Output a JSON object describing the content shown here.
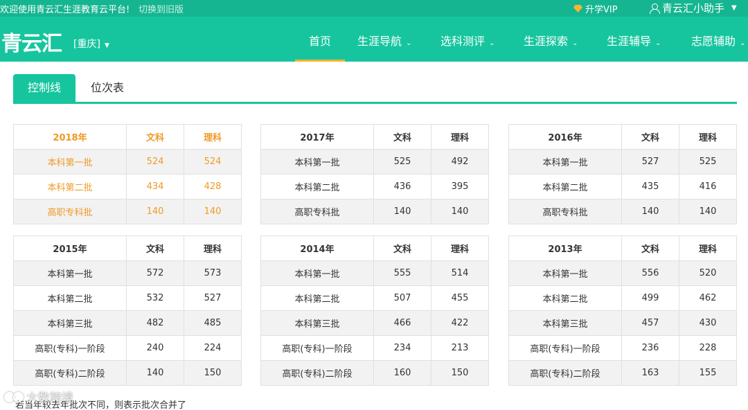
{
  "topbar": {
    "welcome": "欢迎使用青云汇生涯教育云平台!",
    "switch_link": "切换到旧版",
    "vip": "升学VIP",
    "helper": "青云汇小助手"
  },
  "nav": {
    "logo": "青云汇",
    "city": "[重庆]",
    "items": [
      {
        "label": "首页"
      },
      {
        "label": "生涯导航"
      },
      {
        "label": "选科测评"
      },
      {
        "label": "生涯探索"
      },
      {
        "label": "生涯辅导"
      },
      {
        "label": "志愿辅助"
      }
    ]
  },
  "tabs": [
    {
      "label": "控制线"
    },
    {
      "label": "位次表"
    }
  ],
  "colors": {
    "brand": "#16c59e",
    "accent": "#f09a26",
    "vip": "#f7b52d"
  },
  "tables": [
    {
      "year": "2018年",
      "col1": "文科",
      "col2": "理科",
      "rows": [
        {
          "batch": "本科第一批",
          "wen": "524",
          "li": "524"
        },
        {
          "batch": "本科第二批",
          "wen": "434",
          "li": "428"
        },
        {
          "batch": "高职专科批",
          "wen": "140",
          "li": "140"
        }
      ]
    },
    {
      "year": "2017年",
      "col1": "文科",
      "col2": "理科",
      "rows": [
        {
          "batch": "本科第一批",
          "wen": "525",
          "li": "492"
        },
        {
          "batch": "本科第二批",
          "wen": "436",
          "li": "395"
        },
        {
          "batch": "高职专科批",
          "wen": "140",
          "li": "140"
        }
      ]
    },
    {
      "year": "2016年",
      "col1": "文科",
      "col2": "理科",
      "rows": [
        {
          "batch": "本科第一批",
          "wen": "527",
          "li": "525"
        },
        {
          "batch": "本科第二批",
          "wen": "435",
          "li": "416"
        },
        {
          "batch": "高职专科批",
          "wen": "140",
          "li": "140"
        }
      ]
    },
    {
      "year": "2015年",
      "col1": "文科",
      "col2": "理科",
      "rows": [
        {
          "batch": "本科第一批",
          "wen": "572",
          "li": "573"
        },
        {
          "batch": "本科第二批",
          "wen": "532",
          "li": "527"
        },
        {
          "batch": "本科第三批",
          "wen": "482",
          "li": "485"
        },
        {
          "batch": "高职(专科)一阶段",
          "wen": "240",
          "li": "224"
        },
        {
          "batch": "高职(专科)二阶段",
          "wen": "140",
          "li": "150"
        }
      ]
    },
    {
      "year": "2014年",
      "col1": "文科",
      "col2": "理科",
      "rows": [
        {
          "batch": "本科第一批",
          "wen": "555",
          "li": "514"
        },
        {
          "batch": "本科第二批",
          "wen": "507",
          "li": "455"
        },
        {
          "batch": "本科第三批",
          "wen": "466",
          "li": "422"
        },
        {
          "batch": "高职(专科)一阶段",
          "wen": "234",
          "li": "213"
        },
        {
          "batch": "高职(专科)二阶段",
          "wen": "160",
          "li": "150"
        }
      ]
    },
    {
      "year": "2013年",
      "col1": "文科",
      "col2": "理科",
      "rows": [
        {
          "batch": "本科第一批",
          "wen": "556",
          "li": "520"
        },
        {
          "batch": "本科第二批",
          "wen": "499",
          "li": "462"
        },
        {
          "batch": "本科第三批",
          "wen": "457",
          "li": "430"
        },
        {
          "batch": "高职(专科)一阶段",
          "wen": "236",
          "li": "228"
        },
        {
          "batch": "高职(专科)二阶段",
          "wen": "163",
          "li": "155"
        }
      ]
    }
  ],
  "note": "若当年较去年批次不同，则表示批次合并了",
  "watermark": "大数跨境"
}
